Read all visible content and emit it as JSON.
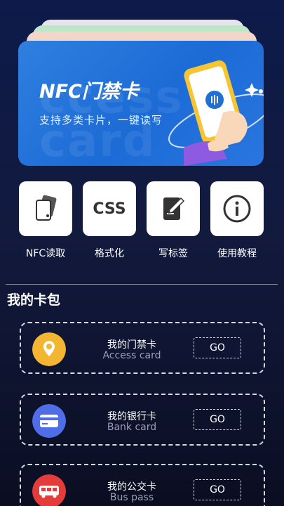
{
  "banner": {
    "title": "NFC门禁卡",
    "subtitle": "支持多类卡片，一键读写",
    "bg_text": "ccess card"
  },
  "functions": [
    {
      "label": "NFC读取",
      "icon": "nfc-card-icon"
    },
    {
      "label": "格式化",
      "icon_text": "CSS",
      "icon": "css-format-icon"
    },
    {
      "label": "写标签",
      "icon": "write-tag-icon"
    },
    {
      "label": "使用教程",
      "icon": "info-icon"
    }
  ],
  "wallet": {
    "title": "我的卡包",
    "cards": [
      {
        "name": "我的门禁卡",
        "sub": "Access card",
        "button": "GO",
        "icon": "location-pin-icon",
        "color": "#f2b632"
      },
      {
        "name": "我的银行卡",
        "sub": "Bank card",
        "button": "GO",
        "icon": "credit-card-icon",
        "color": "#4f6de8"
      },
      {
        "name": "我的公交卡",
        "sub": "Bus pass",
        "button": "GO",
        "icon": "bus-icon",
        "color": "#e43b3b"
      }
    ]
  },
  "colors": {
    "background": "#0d1a4a",
    "banner": "#1c6bd6",
    "tile": "#ffffff"
  }
}
